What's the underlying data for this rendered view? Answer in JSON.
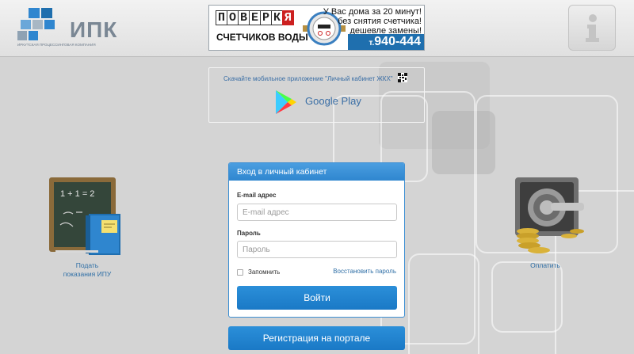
{
  "header": {
    "logo_text": "ИПК",
    "logo_subtitle": "ИРКУТСКАЯ ПРОЦЕССИНГОВАЯ КОМПАНИЯ",
    "ad": {
      "brand_letters": [
        "П",
        "О",
        "В",
        "Е",
        "Р",
        "К",
        "Я"
      ],
      "brand_subtitle": "СЧЕТЧИКОВ ВОДЫ",
      "line1": "У Вас дома за 20 минут!",
      "line2": "без снятия счетчика!",
      "line3": "дешевле замены!",
      "phone_prefix": "т.",
      "phone": "940-444"
    },
    "info_icon": "info-icon"
  },
  "app_promo": {
    "text": "Скачайте мобильное приложение \"Личный кабинет ЖКХ\"",
    "store_label": "Google Play",
    "icons": [
      "qr-code-icon",
      "google-play-icon"
    ]
  },
  "left_widget": {
    "label_line1": "Подать",
    "label_line2": "показания ИПУ",
    "board_text": "1 + 1 = 2",
    "icon": "chalkboard-icon"
  },
  "right_widget": {
    "label": "Оплатить",
    "icon": "safe-icon"
  },
  "login": {
    "title": "Вход в личный кабинет",
    "email_label": "E-mail адрес",
    "email_placeholder": "E-mail адрес",
    "password_label": "Пароль",
    "password_placeholder": "Пароль",
    "remember_label": "Запомнить",
    "restore_link": "Восстановить пароль",
    "submit_label": "Войти"
  },
  "register_label": "Регистрация на портале",
  "colors": {
    "accent": "#2b8fd9",
    "link": "#2f6fa6",
    "background": "#d4d4d4"
  }
}
